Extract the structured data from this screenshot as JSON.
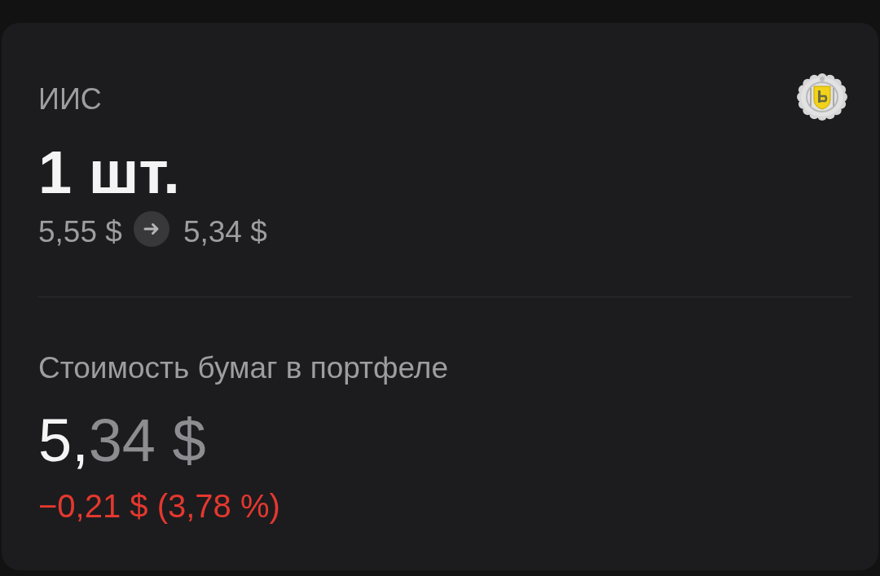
{
  "account": {
    "label": "ИИС",
    "quantity": "1 шт.",
    "price_from": "5,55 $",
    "price_to": "5,34 $"
  },
  "portfolio": {
    "label": "Стоимость бумаг в портфеле",
    "value": {
      "integer": "5,",
      "fraction": "34 $"
    },
    "change": {
      "text": "−0,21 $ (3,78 %)",
      "negative": true
    }
  }
}
